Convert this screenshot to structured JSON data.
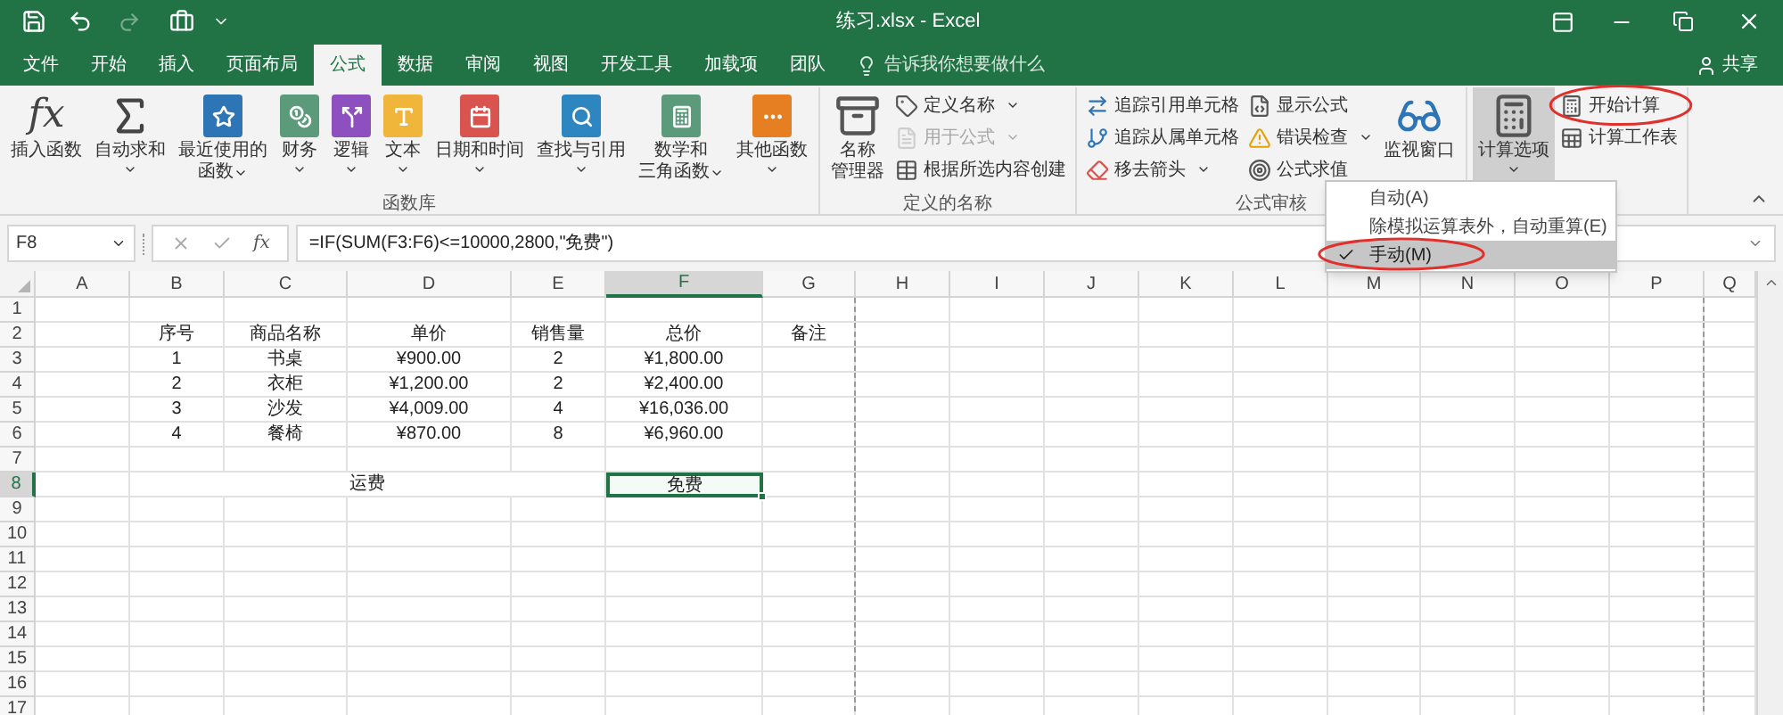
{
  "title_bar": {
    "title": "练习.xlsx - Excel"
  },
  "tabs": [
    {
      "label": "文件",
      "selected": false
    },
    {
      "label": "开始",
      "selected": false
    },
    {
      "label": "插入",
      "selected": false
    },
    {
      "label": "页面布局",
      "selected": false
    },
    {
      "label": "公式",
      "selected": true
    },
    {
      "label": "数据",
      "selected": false
    },
    {
      "label": "审阅",
      "selected": false
    },
    {
      "label": "视图",
      "selected": false
    },
    {
      "label": "开发工具",
      "selected": false
    },
    {
      "label": "加载项",
      "selected": false
    },
    {
      "label": "团队",
      "selected": false
    }
  ],
  "tell_me": {
    "placeholder": "告诉我你想要做什么"
  },
  "share": {
    "label": "共享"
  },
  "ribbon_groups": [
    {
      "label": "函数库",
      "buttons": [
        {
          "kind": "large",
          "lines": [
            "插入函数"
          ],
          "glyph": "fx",
          "dropdown": false,
          "pressed": false
        },
        {
          "kind": "large",
          "lines": [
            "自动求和"
          ],
          "dropdown": true,
          "pressed": false
        },
        {
          "kind": "large",
          "lines": [
            "最近使用的",
            "函数"
          ],
          "dropdown": true,
          "pressed": false
        },
        {
          "kind": "large",
          "lines": [
            "财务"
          ],
          "dropdown": true,
          "pressed": false
        },
        {
          "kind": "large",
          "lines": [
            "逻辑"
          ],
          "dropdown": true,
          "pressed": false
        },
        {
          "kind": "large",
          "lines": [
            "文本"
          ],
          "dropdown": true,
          "pressed": false
        },
        {
          "kind": "large",
          "lines": [
            "日期和时间"
          ],
          "dropdown": true,
          "pressed": false
        },
        {
          "kind": "large",
          "lines": [
            "查找与引用"
          ],
          "dropdown": true,
          "pressed": false
        },
        {
          "kind": "large",
          "lines": [
            "数学和",
            "三角函数"
          ],
          "dropdown": true,
          "pressed": false
        },
        {
          "kind": "large",
          "lines": [
            "其他函数"
          ],
          "dropdown": true,
          "pressed": false
        }
      ]
    },
    {
      "label": "定义的名称",
      "buttons": [
        {
          "kind": "large",
          "lines": [
            "名称",
            "管理器"
          ],
          "dropdown": false,
          "pressed": false
        },
        {
          "kind": "small",
          "label": "定义名称",
          "dropdown": true,
          "disabled": false,
          "circled": false
        },
        {
          "kind": "small",
          "label": "用于公式",
          "dropdown": true,
          "disabled": true,
          "circled": false
        },
        {
          "kind": "small",
          "label": "根据所选内容创建",
          "dropdown": false,
          "disabled": false,
          "circled": false
        }
      ]
    },
    {
      "label": "公式审核",
      "buttons": [
        {
          "kind": "small",
          "label": "追踪引用单元格",
          "dropdown": false,
          "disabled": false,
          "circled": false
        },
        {
          "kind": "small",
          "label": "追踪从属单元格",
          "dropdown": false,
          "disabled": false,
          "circled": false
        },
        {
          "kind": "small",
          "label": "移去箭头",
          "dropdown": true,
          "disabled": false,
          "circled": false
        },
        {
          "kind": "small",
          "label": "显示公式",
          "dropdown": false,
          "disabled": false,
          "circled": false
        },
        {
          "kind": "small",
          "label": "错误检查",
          "dropdown": true,
          "disabled": false,
          "circled": false
        },
        {
          "kind": "small",
          "label": "公式求值",
          "dropdown": false,
          "disabled": false,
          "circled": false
        },
        {
          "kind": "large",
          "lines": [
            "监视窗口"
          ],
          "dropdown": false,
          "pressed": false
        }
      ]
    },
    {
      "buttons": [
        {
          "kind": "large",
          "lines": [
            "计算选项"
          ],
          "dropdown": true,
          "pressed": true
        },
        {
          "kind": "small",
          "label": "开始计算",
          "dropdown": false,
          "disabled": false,
          "circled": true
        },
        {
          "kind": "small",
          "label": "计算工作表",
          "dropdown": false,
          "disabled": false,
          "circled": false
        }
      ]
    }
  ],
  "formula_bar": {
    "name_box": "F8",
    "glyph": "fx",
    "formula": "=IF(SUM(F3:F6)<=10000,2800,\"免费\")"
  },
  "columns": [
    {
      "label": "A",
      "selected": false
    },
    {
      "label": "B",
      "selected": false
    },
    {
      "label": "C",
      "selected": false
    },
    {
      "label": "D",
      "selected": false
    },
    {
      "label": "E",
      "selected": false
    },
    {
      "label": "F",
      "selected": true
    },
    {
      "label": "G",
      "selected": false
    },
    {
      "label": "H",
      "selected": false
    },
    {
      "label": "I",
      "selected": false
    },
    {
      "label": "J",
      "selected": false
    },
    {
      "label": "K",
      "selected": false
    },
    {
      "label": "L",
      "selected": false
    },
    {
      "label": "M",
      "selected": false
    },
    {
      "label": "N",
      "selected": false
    },
    {
      "label": "O",
      "selected": false
    },
    {
      "label": "P",
      "selected": false
    },
    {
      "label": "Q",
      "selected": false
    }
  ],
  "rows": [
    {
      "header": "1",
      "selected": false
    },
    {
      "header": "2",
      "selected": false,
      "cells": [
        {
          "selected": false
        },
        {
          "value": "序号",
          "selected": false
        },
        {
          "value": "商品名称",
          "selected": false
        },
        {
          "value": "单价",
          "selected": false
        },
        {
          "value": "销售量",
          "selected": false
        },
        {
          "value": "总价",
          "selected": false
        },
        {
          "value": "备注",
          "selected": false
        }
      ]
    },
    {
      "header": "3",
      "selected": false,
      "cells": [
        {
          "selected": false
        },
        {
          "value": "1",
          "selected": false
        },
        {
          "value": "书桌",
          "selected": false
        },
        {
          "value": "¥900.00",
          "selected": false
        },
        {
          "value": "2",
          "selected": false
        },
        {
          "value": "¥1,800.00",
          "selected": false
        }
      ]
    },
    {
      "header": "4",
      "selected": false,
      "cells": [
        {
          "selected": false
        },
        {
          "value": "2",
          "selected": false
        },
        {
          "value": "衣柜",
          "selected": false
        },
        {
          "value": "¥1,200.00",
          "selected": false
        },
        {
          "value": "2",
          "selected": false
        },
        {
          "value": "¥2,400.00",
          "selected": false
        }
      ]
    },
    {
      "header": "5",
      "selected": false,
      "cells": [
        {
          "selected": false
        },
        {
          "value": "3",
          "selected": false
        },
        {
          "value": "沙发",
          "selected": false
        },
        {
          "value": "¥4,009.00",
          "selected": false
        },
        {
          "value": "4",
          "selected": false
        },
        {
          "value": "¥16,036.00",
          "selected": false
        }
      ]
    },
    {
      "header": "6",
      "selected": false,
      "cells": [
        {
          "selected": false
        },
        {
          "value": "4",
          "selected": false
        },
        {
          "value": "餐椅",
          "selected": false
        },
        {
          "value": "¥870.00",
          "selected": false
        },
        {
          "value": "8",
          "selected": false
        },
        {
          "value": "¥6,960.00",
          "selected": false
        }
      ]
    },
    {
      "header": "7",
      "selected": false
    },
    {
      "header": "8",
      "selected": true,
      "cells": [
        {
          "selected": false
        },
        {
          "value": "运费",
          "kind": "merged",
          "selected": false
        },
        {
          "value": "免费",
          "kind": "cell",
          "selected": true
        }
      ]
    },
    {
      "header": "9",
      "selected": false
    },
    {
      "header": "10",
      "selected": false
    },
    {
      "header": "11",
      "selected": false
    },
    {
      "header": "12",
      "selected": false
    },
    {
      "header": "13",
      "selected": false
    },
    {
      "header": "14",
      "selected": false
    },
    {
      "header": "15",
      "selected": false
    },
    {
      "header": "16",
      "selected": false
    },
    {
      "header": "17",
      "selected": false
    }
  ],
  "menu": {
    "items": [
      {
        "label": "自动(A)",
        "checked": false,
        "selected": false,
        "circled": false
      },
      {
        "label": "除模拟运算表外，自动重算(E)",
        "checked": false,
        "selected": false,
        "circled": false
      },
      {
        "label": "手动(M)",
        "checked": true,
        "selected": true,
        "circled": true
      }
    ]
  }
}
